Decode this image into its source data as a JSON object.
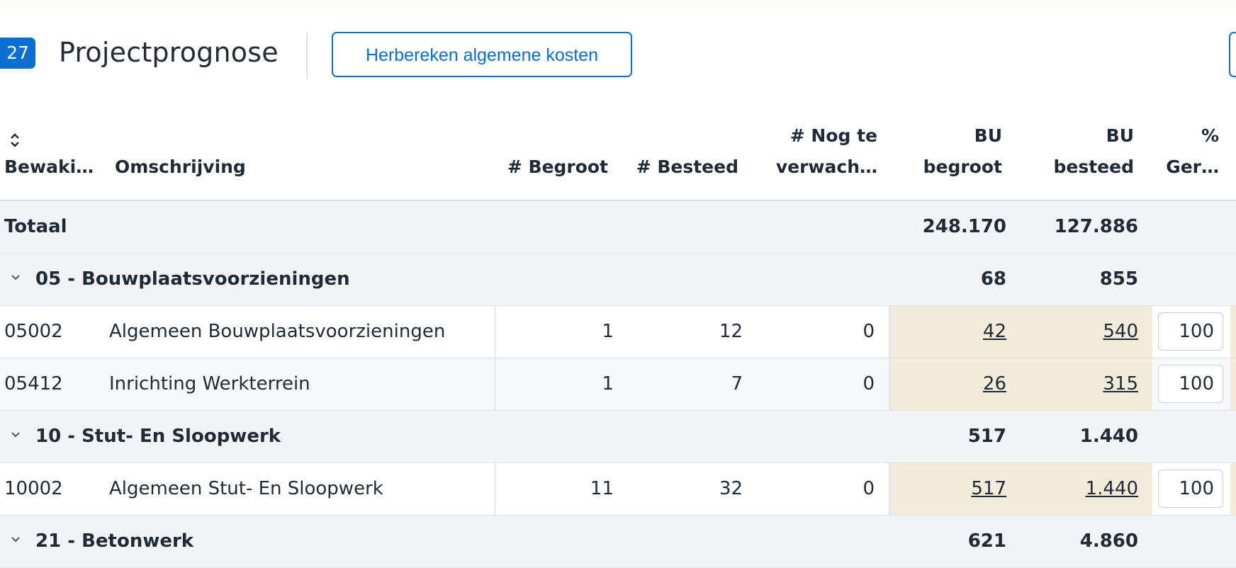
{
  "header": {
    "badge": "27",
    "title": "Projectprognose",
    "recalc_button": "Herbereken algemene kosten"
  },
  "table": {
    "columns": {
      "bewaking": "Bewaki…",
      "omschrijving": "Omschrijving",
      "begroot": "# Begroot",
      "besteed": "# Besteed",
      "nog_te_verwachten_line1": "# Nog te",
      "nog_te_verwachten_line2": "verwach…",
      "bu_begroot_line1": "BU",
      "bu_begroot_line2": "begroot",
      "bu_besteed_line1": "BU",
      "bu_besteed_line2": "besteed",
      "pct_line1": "%",
      "pct_line2": "Ger…"
    },
    "total": {
      "label": "Totaal",
      "bu_begroot": "248.170",
      "bu_besteed": "127.886"
    },
    "groups": [
      {
        "label": "05 - Bouwplaatsvoorzieningen",
        "bu_begroot": "68",
        "bu_besteed": "855",
        "items": [
          {
            "code": "05002",
            "omschrijving": "Algemeen Bouwplaatsvoorzieningen",
            "begroot": "1",
            "besteed": "12",
            "nog": "0",
            "bu_begroot": "42",
            "bu_besteed": "540",
            "pct": "100"
          },
          {
            "code": "05412",
            "omschrijving": "Inrichting Werkterrein",
            "begroot": "1",
            "besteed": "7",
            "nog": "0",
            "bu_begroot": "26",
            "bu_besteed": "315",
            "pct": "100"
          }
        ]
      },
      {
        "label": "10 - Stut- En Sloopwerk",
        "bu_begroot": "517",
        "bu_besteed": "1.440",
        "items": [
          {
            "code": "10002",
            "omschrijving": "Algemeen Stut- En Sloopwerk",
            "begroot": "11",
            "besteed": "32",
            "nog": "0",
            "bu_begroot": "517",
            "bu_besteed": "1.440",
            "pct": "100"
          }
        ]
      },
      {
        "label": "21 - Betonwerk",
        "bu_begroot": "621",
        "bu_besteed": "4.860",
        "items": []
      }
    ]
  },
  "icons": {
    "collapse_all": "collapse-all-icon",
    "chevron": "chevron-down-icon"
  },
  "colors": {
    "accent": "#0a6fd1",
    "group_background": "#f2f4f7",
    "budget_cell_background": "#f4ecdb"
  }
}
